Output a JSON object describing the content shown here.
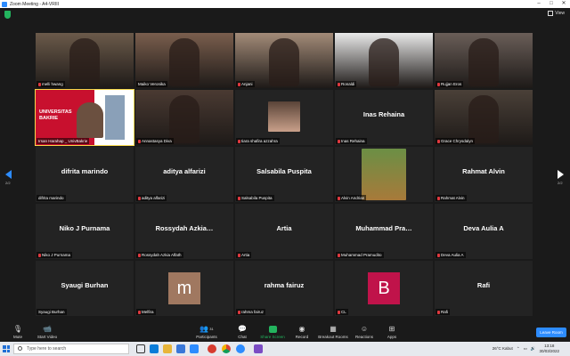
{
  "window": {
    "title": "Zoom Meeting - A4-VRIII",
    "controls": [
      "–",
      "□",
      "✕"
    ]
  },
  "topbar": {
    "view_label": "View"
  },
  "tiles": [
    {
      "label": "melli hwang",
      "type": "video",
      "muted": true
    },
    {
      "label": "Maiko Veronika",
      "type": "video",
      "muted": false
    },
    {
      "label": "Anjani",
      "type": "video",
      "muted": true
    },
    {
      "label": "Ronaldi",
      "type": "video",
      "muted": true
    },
    {
      "label": "Rujjan Eros",
      "type": "video",
      "muted": true
    },
    {
      "label": "Irsan Harahap _ UnivBakrie",
      "type": "video",
      "muted": false,
      "active": true,
      "slide_text": "UNIVERSITAS BAKRIE"
    },
    {
      "label": "Annastasya Diva",
      "type": "video",
      "muted": true
    },
    {
      "label": "tiara shafira azzahra",
      "type": "photo",
      "muted": true
    },
    {
      "label": "Inas Rehaina",
      "type": "name",
      "name": "Inas Rehaina",
      "muted": true
    },
    {
      "label": "Grace Chrysdalyn",
      "type": "video",
      "muted": true
    },
    {
      "label": "difrita marindo",
      "type": "name",
      "name": "difrita marindo",
      "muted": false
    },
    {
      "label": "aditya alfarizi",
      "type": "name",
      "name": "aditya alfarizi",
      "muted": true
    },
    {
      "label": "Salsabila Puspita",
      "type": "name",
      "name": "Salsabila Puspita",
      "muted": true
    },
    {
      "label": "Alvin Andrian",
      "type": "photo",
      "muted": true
    },
    {
      "label": "Rahmat Alvin",
      "type": "name",
      "name": "Rahmat Alvin",
      "muted": true
    },
    {
      "label": "Niko J Purnama",
      "type": "name",
      "name": "Niko J Purnama",
      "muted": true
    },
    {
      "label": "Rossydah Azkia Alfath",
      "type": "name",
      "name": "Rossydah Azkia…",
      "muted": true
    },
    {
      "label": "Artia",
      "type": "name",
      "name": "Artia",
      "muted": true
    },
    {
      "label": "Muhammad Pramudito",
      "type": "name",
      "name": "Muhammad Pra…",
      "muted": true
    },
    {
      "label": "Deva Aulia A",
      "type": "name",
      "name": "Deva Aulia A",
      "muted": true
    },
    {
      "label": "Syaugi Burhan",
      "type": "name",
      "name": "Syaugi Burhan",
      "muted": false
    },
    {
      "label": "Melfira",
      "type": "avatar",
      "letter": "m",
      "color": "#a07860",
      "muted": true
    },
    {
      "label": "rahma fairuz",
      "type": "name",
      "name": "rahma fairuz",
      "muted": true
    },
    {
      "label": "CL",
      "type": "avatar",
      "letter": "B",
      "color": "#c0134a",
      "muted": true
    },
    {
      "label": "Rafi",
      "type": "name",
      "name": "Rafi",
      "muted": true
    }
  ],
  "pager": {
    "left": "2/2",
    "right": "2/2"
  },
  "toolbar": {
    "mute": "Mute",
    "start_video": "Start Video",
    "participants": "Participants",
    "participant_count": "31",
    "chat": "Chat",
    "share_screen": "Share Screen",
    "record": "Record",
    "breakout_rooms": "Breakout Rooms",
    "reactions": "Reactions",
    "apps": "Apps",
    "leave": "Leave Room"
  },
  "taskbar": {
    "search_placeholder": "Type here to search",
    "weather": "26°C Kabut",
    "time": "13:18",
    "date": "30/03/2022"
  },
  "colors": {
    "accent": "#2d8cff",
    "active_speaker": "#f6d84a",
    "share": "#23b45e"
  }
}
